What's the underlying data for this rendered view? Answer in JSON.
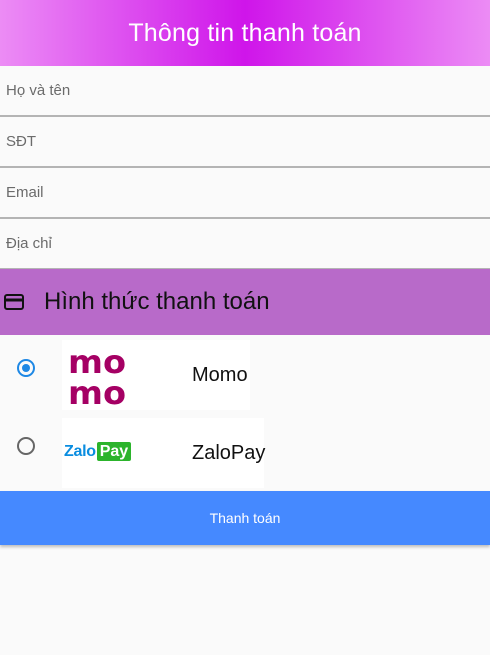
{
  "appbar": {
    "title": "Thông tin thanh toán"
  },
  "form": {
    "name_placeholder": "Họ và tên",
    "phone_placeholder": "SĐT",
    "email_placeholder": "Email",
    "address_placeholder": "Địa chỉ"
  },
  "payment": {
    "section_title": "Hình thức thanh toán",
    "icon": "credit-card-icon",
    "methods": [
      {
        "label": "Momo",
        "logo_text": [
          "mo",
          "mo"
        ],
        "selected": true
      },
      {
        "label": "ZaloPay",
        "logo_text": [
          "Zalo",
          "Pay"
        ],
        "selected": false
      }
    ]
  },
  "submit": {
    "label": "Thanh toán"
  },
  "colors": {
    "appbar_gradient": [
      "#ec8cf5",
      "#cf15ea"
    ],
    "section_header": "#b86ac9",
    "button": "#4589ff",
    "momo": "#a50064",
    "zalo_blue": "#0a8de0",
    "zalo_green": "#2cb42c",
    "radio_selected": "#1e88e5"
  }
}
